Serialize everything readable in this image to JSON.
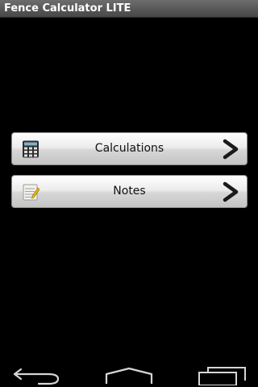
{
  "app": {
    "title": "Fence Calculator LITE"
  },
  "menu": {
    "items": [
      {
        "label": "Calculations",
        "icon": "calculator-icon"
      },
      {
        "label": "Notes",
        "icon": "notepad-icon"
      }
    ]
  },
  "navbar": {
    "buttons": [
      "back-icon",
      "home-icon",
      "recent-apps-icon"
    ]
  },
  "colors": {
    "background": "#000000",
    "titlebar": "#5a5a5a",
    "button": "#e6e6e6",
    "chevron": "#1a1a1a"
  }
}
